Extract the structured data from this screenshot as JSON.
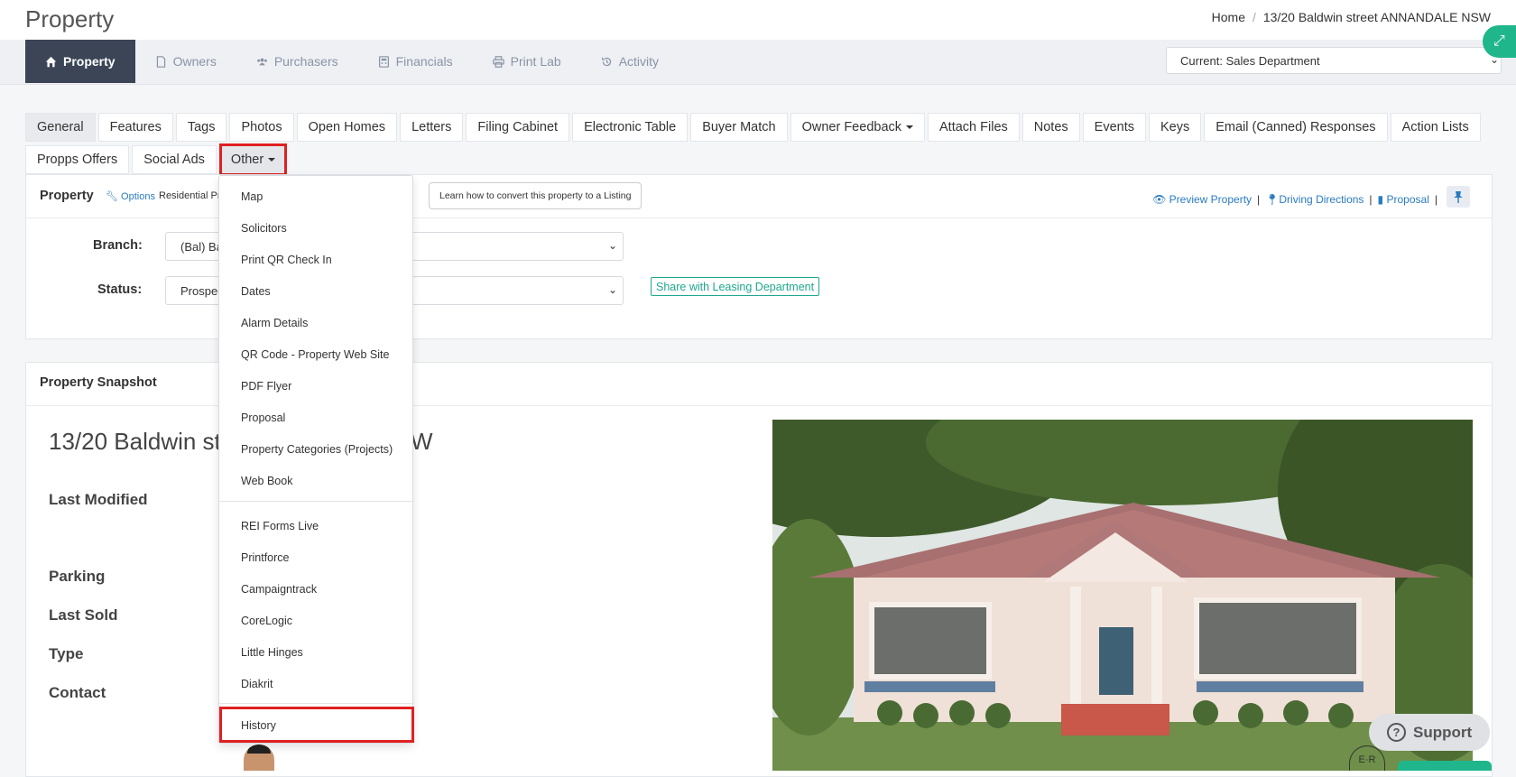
{
  "header": {
    "page_title": "Property",
    "breadcrumb": [
      "Home",
      "/",
      "13/20 Baldwin street ANNANDALE NSW"
    ]
  },
  "main_nav": [
    {
      "label": "Property",
      "icon": "home-icon",
      "active": true
    },
    {
      "label": "Owners",
      "icon": "document-icon"
    },
    {
      "label": "Purchasers",
      "icon": "users-icon"
    },
    {
      "label": "Financials",
      "icon": "calculator-icon"
    },
    {
      "label": "Print Lab",
      "icon": "printer-icon"
    },
    {
      "label": "Activity",
      "icon": "history-icon"
    }
  ],
  "department": {
    "value": "Current: Sales Department"
  },
  "sub_tabs_row1": [
    "General",
    "Features",
    "Tags",
    "Photos",
    "Open Homes",
    "Letters",
    "Filing Cabinet",
    "Electronic Table",
    "Buyer Match",
    "Owner Feedback",
    "Attach Files",
    "Notes",
    "Events",
    "Keys",
    "Email (Canned) Responses",
    "Action Lists"
  ],
  "sub_tabs_row2": [
    "Propps Offers",
    "Social Ads",
    "Other"
  ],
  "property_panel": {
    "title": "Property",
    "options_label": "Options",
    "residential_text": "Residential Pr",
    "learn_button": "Learn how to convert this property to a Listing",
    "links": {
      "preview": "Preview Property",
      "directions": "Driving Directions",
      "proposal": "Proposal",
      "sep": "|"
    },
    "branch_label": "Branch:",
    "branch_value": "(Bal) Ba",
    "status_label": "Status:",
    "status_value": "Prospec",
    "share_button": "Share with Leasing Department"
  },
  "snapshot": {
    "title": "Property Snapshot",
    "address_start": "13/20 Baldwin str",
    "address_end": "W",
    "labels": [
      "Last Modified",
      "Parking",
      "Last Sold",
      "Type",
      "Contact"
    ]
  },
  "other_menu": {
    "group1": [
      "Map",
      "Solicitors",
      "Print QR Check In",
      "Dates",
      "Alarm Details",
      "QR Code - Property Web Site",
      "PDF Flyer",
      "Proposal",
      "Property Categories (Projects)",
      "Web Book"
    ],
    "group2": [
      "REI Forms Live",
      "Printforce",
      "Campaigntrack",
      "CoreLogic",
      "Little Hinges",
      "Diakrit"
    ],
    "history": "History"
  },
  "support": {
    "label": "Support"
  },
  "badge": {
    "label": "E·R"
  },
  "colors": {
    "accent_green": "#1fb68c",
    "nav_active": "#3b4556",
    "link_blue": "#2a7bbf",
    "highlight_red": "#e02020"
  }
}
